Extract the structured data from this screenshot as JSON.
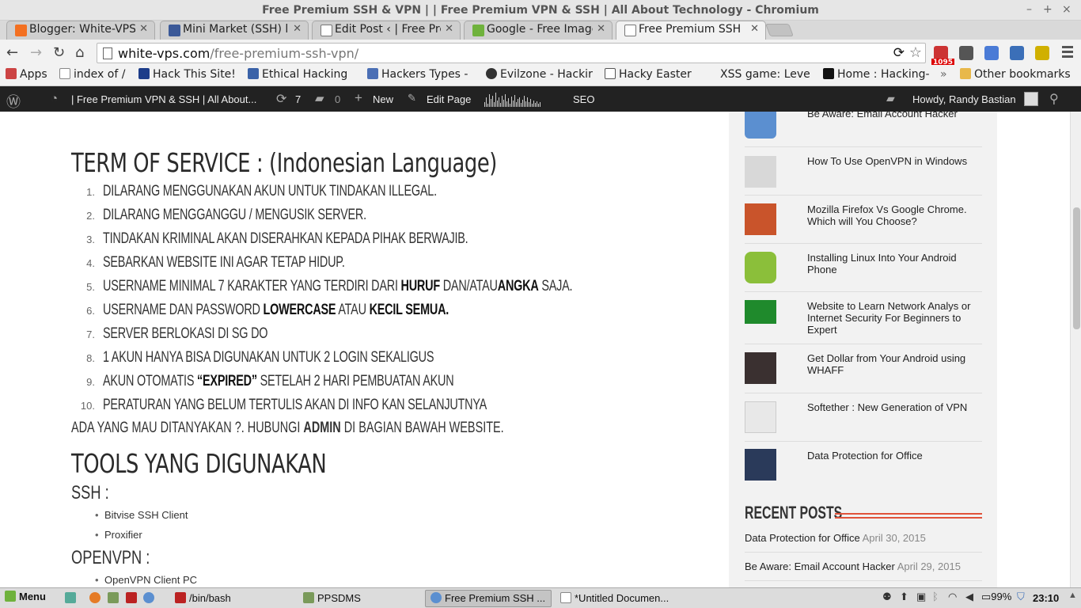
{
  "window": {
    "title": "Free Premium SSH & VPN | | Free Premium VPN & SSH | All About Technology - Chromium",
    "controls": [
      "–",
      "+",
      "×"
    ]
  },
  "tabs": [
    {
      "label": "Blogger: White-VPS",
      "icon_color": "#f37021"
    },
    {
      "label": "Mini Market (SSH) li",
      "icon_color": "#3b5998"
    },
    {
      "label": "Edit Post ‹ | Free Pre",
      "icon_color": "#ffffff"
    },
    {
      "label": "Google - Free Image",
      "icon_color": "#6fb23c"
    },
    {
      "label": "Free Premium SSH",
      "icon_color": "#ffffff"
    }
  ],
  "toolbar": {
    "url_host": "white-vps.com",
    "url_path": "/free-premium-ssh-vpn/",
    "ext_badge": "1095"
  },
  "bookmarks": {
    "items": [
      "Apps",
      "index of /",
      "Hack This Site!",
      "Ethical Hacking",
      "Hackers Types -",
      "Evilzone - Hackir",
      "Hacky Easter",
      "XSS game: Leve",
      "Home : Hacking-"
    ],
    "overflow": "»",
    "other": "Other bookmarks"
  },
  "adminbar": {
    "site_title": "| Free Premium VPN & SSH | All About...",
    "updates_count": "7",
    "comments_count": "0",
    "new_label": "New",
    "edit_label": "Edit Page",
    "seo_label": "SEO",
    "howdy": "Howdy, Randy Bastian"
  },
  "main": {
    "tos_heading": "TERM OF SERVICE : (Indonesian Language)",
    "tos_items": [
      {
        "num": "1.",
        "parts": [
          [
            "DILARANG MENGGUNAKAN AKUN UNTUK TINDAKAN ILLEGAL.",
            false
          ]
        ]
      },
      {
        "num": "2.",
        "parts": [
          [
            "DILARANG MENGGANGGU / MENGUSIK SERVER.",
            false
          ]
        ]
      },
      {
        "num": "3.",
        "parts": [
          [
            "TINDAKAN KRIMINAL AKAN DISERAHKAN KEPADA PIHAK BERWAJIB.",
            false
          ]
        ]
      },
      {
        "num": "4.",
        "parts": [
          [
            "SEBARKAN WEBSITE INI AGAR TETAP HIDUP.",
            false
          ]
        ]
      },
      {
        "num": "5.",
        "parts": [
          [
            "USERNAME MINIMAL 7 KARAKTER YANG TERDIRI DARI ",
            false
          ],
          [
            "HURUF",
            true
          ],
          [
            " DAN/ATAU",
            false
          ],
          [
            "ANGKA",
            true
          ],
          [
            " SAJA.",
            false
          ]
        ]
      },
      {
        "num": "6.",
        "parts": [
          [
            "USERNAME DAN PASSWORD ",
            false
          ],
          [
            "LOWERCASE",
            true
          ],
          [
            " ATAU ",
            false
          ],
          [
            "KECIL SEMUA.",
            true
          ]
        ]
      },
      {
        "num": "7.",
        "parts": [
          [
            "SERVER BERLOKASI DI SG DO",
            false
          ]
        ]
      },
      {
        "num": "8.",
        "parts": [
          [
            "1 AKUN HANYA BISA DIGUNAKAN UNTUK 2 LOGIN SEKALIGUS",
            false
          ]
        ]
      },
      {
        "num": "9.",
        "parts": [
          [
            "AKUN OTOMATIS ",
            false
          ],
          [
            "“EXPIRED”",
            true
          ],
          [
            " SETELAH 2 HARI PEMBUATAN AKUN",
            false
          ]
        ]
      },
      {
        "num": "10.",
        "parts": [
          [
            "PERATURAN YANG BELUM TERTULIS AKAN DI INFO KAN SELANJUTNYA",
            false
          ]
        ]
      }
    ],
    "ask_text_pre": "ADA YANG MAU DITANYAKAN ?. HUBUNGI ",
    "ask_text_bold": "ADMIN",
    "ask_text_post": " DI BAGIAN BAWAH WEBSITE.",
    "tools_heading": "TOOLS YANG DIGUNAKAN",
    "ssh_heading": "SSH :",
    "ssh_tools": [
      "Bitvise SSH Client",
      "Proxifier"
    ],
    "openvpn_heading": "OPENVPN :",
    "openvpn_tools": [
      "OpenVPN Client PC"
    ]
  },
  "sidebar": {
    "posts": [
      {
        "title": "Be Aware: Email Account Hacker",
        "thumb": "#5b8fd0"
      },
      {
        "title": "How To Use OpenVPN in Windows",
        "thumb": "#d8d8d8"
      },
      {
        "title": "Mozilla Firefox Vs Google Chrome. Which will You Choose?",
        "thumb": "#c9542b"
      },
      {
        "title": "Installing Linux Into Your Android Phone",
        "thumb": "#8bbf3a"
      },
      {
        "title": "Website to Learn Network Analys or Internet Security For Beginners to Expert",
        "thumb": "#1f8a2c"
      },
      {
        "title": "Get Dollar from Your Android using WHAFF",
        "thumb": "#3a3030"
      },
      {
        "title": "Softether : New Generation of VPN",
        "thumb": "#e8e8e8"
      },
      {
        "title": "Data Protection for Office",
        "thumb": "#2a3a5a"
      }
    ],
    "recent_heading": "RECENT POSTS",
    "recent": [
      {
        "title": "Data Protection for Office",
        "date": "April 30, 2015"
      },
      {
        "title": "Be Aware: Email Account Hacker",
        "date": "April 29, 2015"
      }
    ]
  },
  "taskbar": {
    "menu": "Menu",
    "windows": [
      "/bin/bash",
      "PPSDMS",
      "Free Premium SSH ...",
      "*Untitled Documen..."
    ],
    "battery": "99%",
    "clock": "23:10"
  },
  "colors": {
    "accent_red": "#e0533b",
    "adminbar_bg": "#222222"
  }
}
